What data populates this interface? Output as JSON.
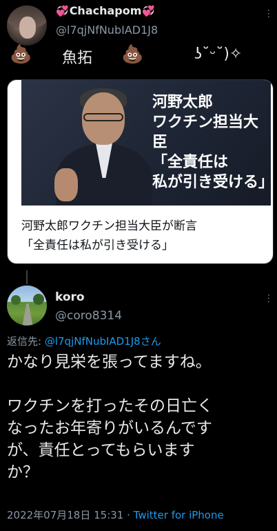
{
  "tweet": {
    "author_name": "Chachapom",
    "author_handle": "@l7qjNfNubIAD1J8",
    "body_poop": "💩",
    "body_text": "魚拓",
    "body_kaomoji": "ʖ˘ᵕ˘)✧",
    "more_icon": "⋮",
    "card": {
      "image_overlay_lines": [
        "河野太郎",
        "ワクチン担当大臣",
        "「全責任は",
        "私が引き受ける」"
      ],
      "title_line1": "河野太郎ワクチン担当大臣が断言",
      "title_line2": "「全責任は私が引き受ける」"
    }
  },
  "reply": {
    "author_name": "koro",
    "author_handle": "@coro8314",
    "reply_to_prefix": "返信先: ",
    "reply_to_handle": "@l7qjNfNubIAD1J8さん",
    "body": "かなり見栄を張ってますね。\n\nワクチンを打ったその日亡く\nなったお年寄りがいるんです\nが、責任とってもらいます\nか？",
    "timestamp": "2022年07月18日 15:31 · ",
    "source": "Twitter for iPhone"
  },
  "colors": {
    "background": "#000000",
    "text": "#e7e9ea",
    "muted": "#8b98a5",
    "link": "#1d9bf0",
    "heart": "#f06292"
  }
}
